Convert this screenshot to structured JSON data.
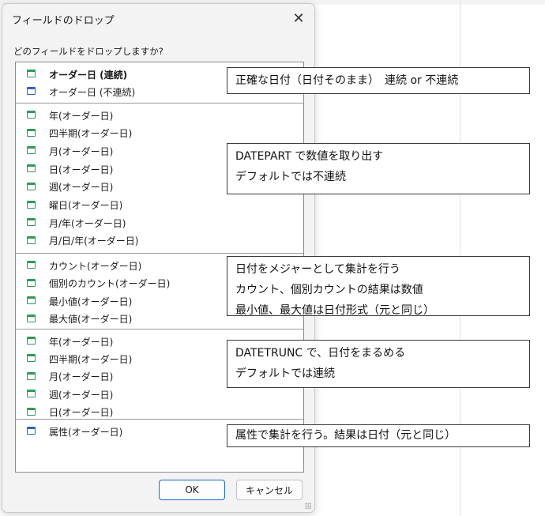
{
  "dialog": {
    "title": "フィールドのドロップ",
    "close": "✕",
    "prompt": "どのフィールドをドロップしますか?",
    "ok": "OK",
    "cancel": "キャンセル"
  },
  "groups": [
    {
      "items": [
        {
          "label": "オーダー日 (連続)",
          "icon": "calendar-icon",
          "bold": true
        },
        {
          "label": "オーダー日 (不連続)",
          "icon": "calendar-icon"
        }
      ]
    },
    {
      "items": [
        {
          "label": "年(オーダー日)",
          "icon": "calendar-icon"
        },
        {
          "label": "四半期(オーダー日)",
          "icon": "calendar-icon"
        },
        {
          "label": "月(オーダー日)",
          "icon": "calendar-icon"
        },
        {
          "label": "日(オーダー日)",
          "icon": "calendar-icon"
        },
        {
          "label": "週(オーダー日)",
          "icon": "calendar-icon"
        },
        {
          "label": "曜日(オーダー日)",
          "icon": "calendar-icon"
        },
        {
          "label": "月/年(オーダー日)",
          "icon": "calendar-icon"
        },
        {
          "label": "月/日/年(オーダー日)",
          "icon": "calendar-icon"
        }
      ]
    },
    {
      "items": [
        {
          "label": "カウント(オーダー日)",
          "icon": "calendar-icon"
        },
        {
          "label": "個別のカウント(オーダー日)",
          "icon": "calendar-icon"
        },
        {
          "label": "最小値(オーダー日)",
          "icon": "calendar-icon"
        },
        {
          "label": "最大値(オーダー日)",
          "icon": "calendar-icon"
        }
      ]
    },
    {
      "items": [
        {
          "label": "年(オーダー日)",
          "icon": "calendar-icon"
        },
        {
          "label": "四半期(オーダー日)",
          "icon": "calendar-icon"
        },
        {
          "label": "月(オーダー日)",
          "icon": "calendar-icon"
        },
        {
          "label": "週(オーダー日)",
          "icon": "calendar-icon"
        },
        {
          "label": "日(オーダー日)",
          "icon": "calendar-icon"
        }
      ]
    },
    {
      "items": [
        {
          "label": "属性(オーダー日)",
          "icon": "calendar-icon"
        }
      ]
    }
  ],
  "notes": [
    {
      "lines": [
        "正確な日付（日付そのまま）　連続 or 不連続"
      ]
    },
    {
      "lines": [
        "DATEPART で数値を取り出す",
        "デフォルトでは不連続"
      ]
    },
    {
      "lines": [
        "日付をメジャーとして集計を行う",
        "カウント、個別カウントの結果は数値",
        "最小値、最大値は日付形式（元と同じ）"
      ]
    },
    {
      "lines": [
        "DATETRUNC で、日付をまるめる",
        "デフォルトでは連続"
      ]
    },
    {
      "lines": [
        "属性で集計を行う。結果は日付（元と同じ）"
      ]
    }
  ],
  "colors": {
    "continuous": "#2e9b58",
    "discrete": "#2f66b8",
    "primary_border": "#1f66c5"
  }
}
